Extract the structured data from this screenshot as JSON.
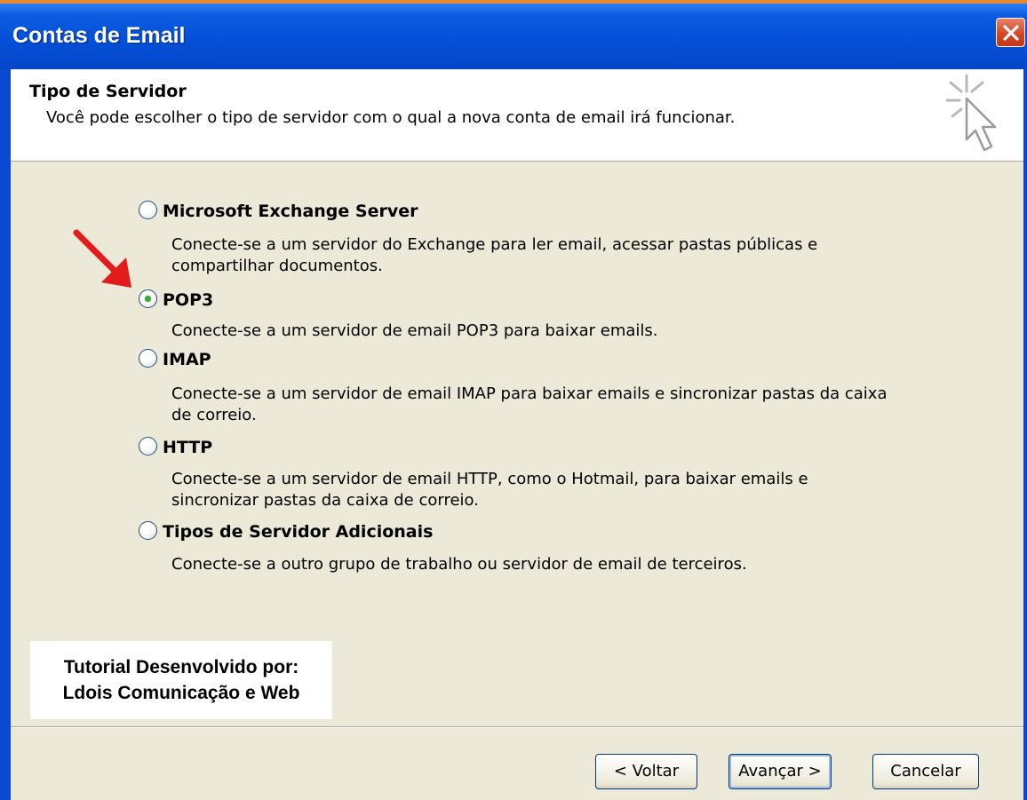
{
  "window": {
    "title": "Contas de Email",
    "close_icon": "close-icon"
  },
  "header": {
    "title": "Tipo de Servidor",
    "subtitle": "Você pode escolher o tipo de servidor com o qual a nova conta de email irá funcionar.",
    "icon": "cursor-sparkle-icon"
  },
  "options": [
    {
      "label": "Microsoft Exchange Server",
      "selected": false,
      "description": "Conecte-se a um servidor do Exchange para ler email, acessar pastas públicas e compartilhar documentos."
    },
    {
      "label": "POP3",
      "selected": true,
      "description": "Conecte-se a um servidor de email POP3 para baixar emails."
    },
    {
      "label": "IMAP",
      "selected": false,
      "description": "Conecte-se a um servidor de email IMAP para baixar emails e sincronizar pastas da caixa de correio."
    },
    {
      "label": "HTTP",
      "selected": false,
      "description": "Conecte-se a um servidor de email HTTP, como o Hotmail, para baixar emails e sincronizar pastas da caixa de correio."
    },
    {
      "label": "Tipos de Servidor Adicionais",
      "selected": false,
      "description": "Conecte-se a outro grupo de trabalho ou servidor de email de terceiros."
    }
  ],
  "annotation": {
    "arrow_icon": "red-arrow-icon",
    "arrow_color": "#e21b1b"
  },
  "credit": {
    "line1": "Tutorial Desenvolvido por:",
    "line2": "Ldois Comunicação e Web"
  },
  "buttons": {
    "back": "< Voltar",
    "next": "Avançar >",
    "cancel": "Cancelar"
  },
  "colors": {
    "titlebar": "#0550d8",
    "dialog_bg": "#ece9d8",
    "radio_dot": "#3faa3f"
  }
}
